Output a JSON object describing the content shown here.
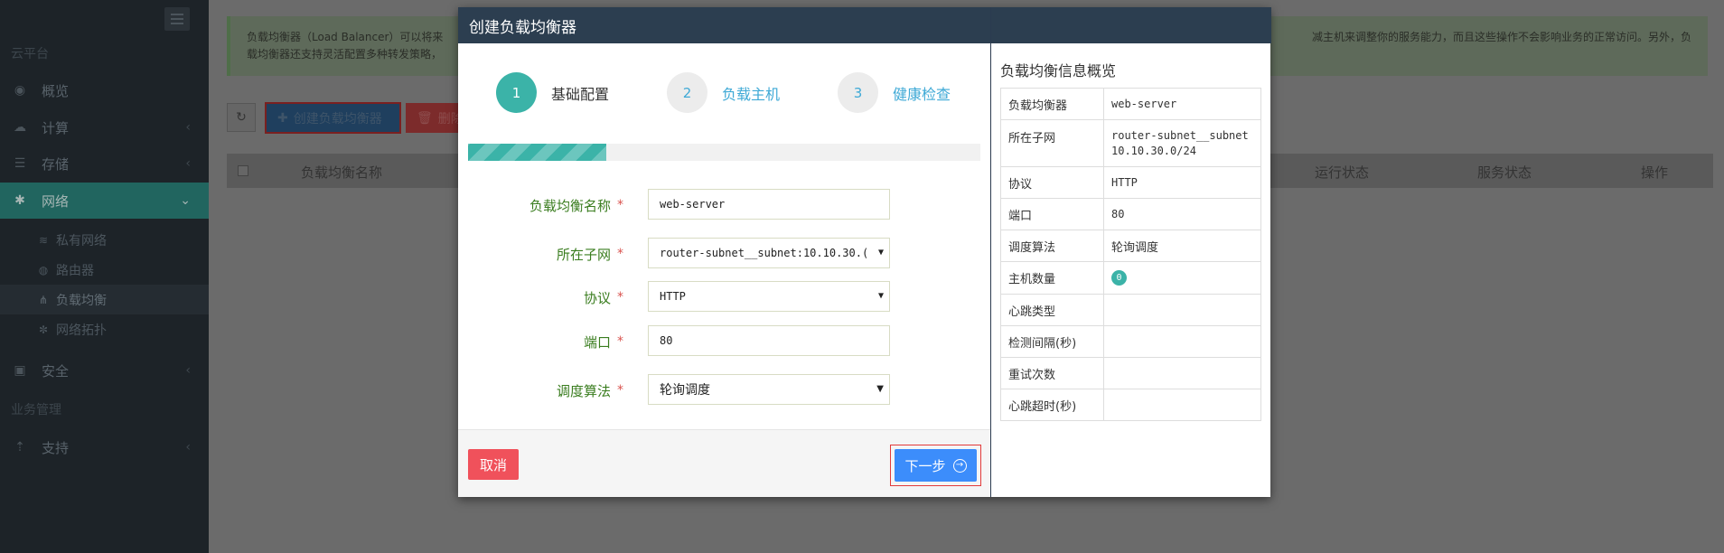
{
  "sidebar": {
    "section_cloud": "云平台",
    "section_business": "业务管理",
    "items": [
      {
        "label": "概览",
        "icon": "dashboard-icon"
      },
      {
        "label": "计算",
        "icon": "cloud-icon"
      },
      {
        "label": "存储",
        "icon": "database-icon"
      },
      {
        "label": "网络",
        "icon": "network-icon"
      },
      {
        "label": "安全",
        "icon": "lock-icon"
      },
      {
        "label": "支持",
        "icon": "support-icon"
      }
    ],
    "sub_items": [
      {
        "label": "私有网络",
        "icon": "wifi-icon"
      },
      {
        "label": "路由器",
        "icon": "globe-icon"
      },
      {
        "label": "负载均衡",
        "icon": "sitemap-icon"
      },
      {
        "label": "网络拓扑",
        "icon": "topology-icon"
      }
    ]
  },
  "main": {
    "info_line1": "负载均衡器（Load Balancer）可以将来",
    "info_line1_right": "减主机来调整你的服务能力，而且这些操作不会影响业务的正常访问。另外，负",
    "info_line2": "载均衡器还支持灵活配置多种转发策略，",
    "create_button": "创建负载均衡器",
    "delete_button": "删除",
    "columns": [
      "负载均衡名称",
      "运行状态",
      "服务状态",
      "操作"
    ]
  },
  "modal": {
    "title": "创建负载均衡器",
    "steps": [
      {
        "num": "1",
        "label": "基础配置",
        "active": true
      },
      {
        "num": "2",
        "label": "负载主机",
        "active": false
      },
      {
        "num": "3",
        "label": "健康检查",
        "active": false
      }
    ],
    "progress_fraction": 0.27,
    "form": {
      "name_label": "负载均衡名称",
      "name_value": "web-server",
      "subnet_label": "所在子网",
      "subnet_value": "router-subnet__subnet:10.10.30.(",
      "protocol_label": "协议",
      "protocol_value": "HTTP",
      "port_label": "端口",
      "port_value": "80",
      "algo_label": "调度算法",
      "algo_value": "轮询调度",
      "required_mark": "*"
    },
    "cancel_button": "取消",
    "next_button": "下一步",
    "overview": {
      "title": "负载均衡信息概览",
      "rows": [
        {
          "key": "负载均衡器",
          "value": "web-server"
        },
        {
          "key": "所在子网",
          "value": "router-subnet__subnet",
          "value2": "10.10.30.0/24"
        },
        {
          "key": "协议",
          "value": "HTTP"
        },
        {
          "key": "端口",
          "value": "80"
        },
        {
          "key": "调度算法",
          "value": "轮询调度"
        },
        {
          "key": "主机数量",
          "value": "0"
        },
        {
          "key": "心跳类型",
          "value": ""
        },
        {
          "key": "检测间隔(秒)",
          "value": ""
        },
        {
          "key": "重试次数",
          "value": ""
        },
        {
          "key": "心跳超时(秒)",
          "value": ""
        }
      ]
    }
  }
}
